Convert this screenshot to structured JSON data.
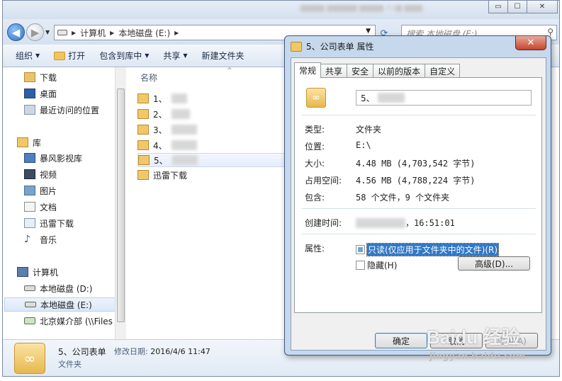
{
  "explorer": {
    "window_controls": {
      "minimize": "▭",
      "maximize": "☐",
      "close": "✕"
    },
    "address": {
      "crumbs": [
        "计算机",
        "本地磁盘 (E:)"
      ]
    },
    "search": {
      "placeholder": "搜索 本地磁盘 (E:)"
    },
    "toolbar": {
      "organize": "组织",
      "open": "打开",
      "include_in_library": "包含到库中",
      "share": "共享",
      "new_folder": "新建文件夹"
    },
    "nav": {
      "favorites": [
        "下载",
        "桌面",
        "最近访问的位置"
      ],
      "libraries_header": "库",
      "libraries": [
        "暴风影视库",
        "视频",
        "图片",
        "文档",
        "迅雷下载",
        "音乐"
      ],
      "computer_header": "计算机",
      "drives": [
        "本地磁盘 (D:)",
        "本地磁盘 (E:)",
        "北京媒介部 (\\\\Files"
      ]
    },
    "files": {
      "column_name": "名称",
      "items": [
        "1、",
        "2、",
        "3、",
        "4、",
        "5、",
        "迅雷下载"
      ]
    },
    "details": {
      "name": "5、公司表单",
      "modified_label": "修改日期:",
      "modified_value": "2016/4/6 11:47",
      "type": "文件夹"
    }
  },
  "dialog": {
    "title": "5、公司表单 属性",
    "tabs": [
      "常规",
      "共享",
      "安全",
      "以前的版本",
      "自定义"
    ],
    "active_tab": "常规",
    "name_prefix": "5、",
    "rows": {
      "type_label": "类型:",
      "type_value": "文件夹",
      "location_label": "位置:",
      "location_value": "E:\\",
      "size_label": "大小:",
      "size_value": "4.48 MB (4,703,542 字节)",
      "disk_label": "占用空间:",
      "disk_value": "4.56 MB (4,788,224 字节)",
      "contains_label": "包含:",
      "contains_value": "58 个文件，9 个文件夹",
      "created_label": "创建时间:",
      "created_value": "，16:51:01",
      "attributes_label": "属性:"
    },
    "attributes": {
      "readonly": "只读(仅应用于文件夹中的文件)(R)",
      "hidden": "隐藏(H)",
      "advanced": "高级(D)..."
    },
    "buttons": {
      "ok": "确定",
      "cancel": "取消",
      "apply": "应用(A)"
    }
  },
  "watermark": {
    "brand": "Baidu 经验",
    "url": "jingyan.baidu.com"
  }
}
